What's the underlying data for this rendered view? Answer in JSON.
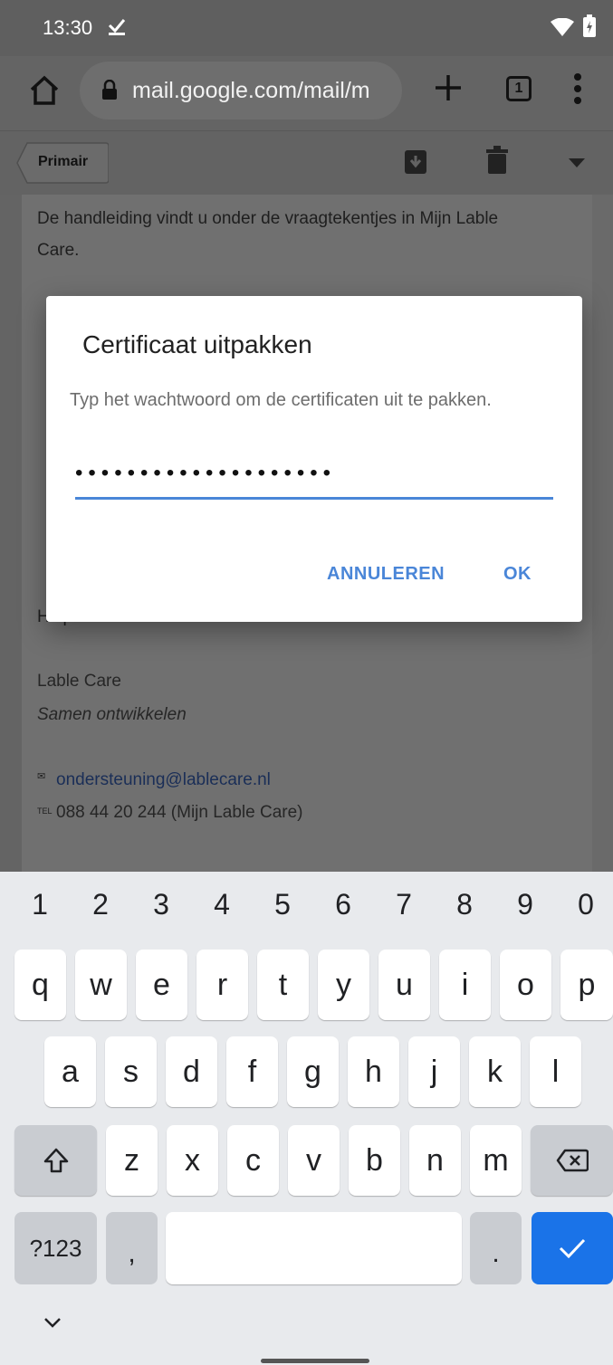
{
  "status": {
    "time": "13:30"
  },
  "browser": {
    "url": "mail.google.com/mail/m",
    "tab_count": "1"
  },
  "mail": {
    "back_label": "Primair",
    "lines": [
      "De handleiding vindt u onder de vraagtekentjes in Mijn Lable",
      "Care.",
      "Helpdesk Team",
      "Lable Care",
      "Samen ontwikkelen",
      "ondersteuning@lablecare.nl",
      "088 44 20 244 (Mijn Lable Care)"
    ]
  },
  "dialog": {
    "title": "Certificaat uitpakken",
    "message": "Typ het wachtwoord om de certificaten uit te pakken.",
    "password_mask": "••••••••••••••••••••",
    "cancel_label": "ANNULEREN",
    "ok_label": "OK"
  },
  "keyboard": {
    "numbers": [
      "1",
      "2",
      "3",
      "4",
      "5",
      "6",
      "7",
      "8",
      "9",
      "0"
    ],
    "row1": [
      "q",
      "w",
      "e",
      "r",
      "t",
      "y",
      "u",
      "i",
      "o",
      "p"
    ],
    "row2": [
      "a",
      "s",
      "d",
      "f",
      "g",
      "h",
      "j",
      "k",
      "l"
    ],
    "row3": [
      "z",
      "x",
      "c",
      "v",
      "b",
      "n",
      "m"
    ],
    "symbols_label": "?123",
    "comma": ",",
    "period": "."
  }
}
